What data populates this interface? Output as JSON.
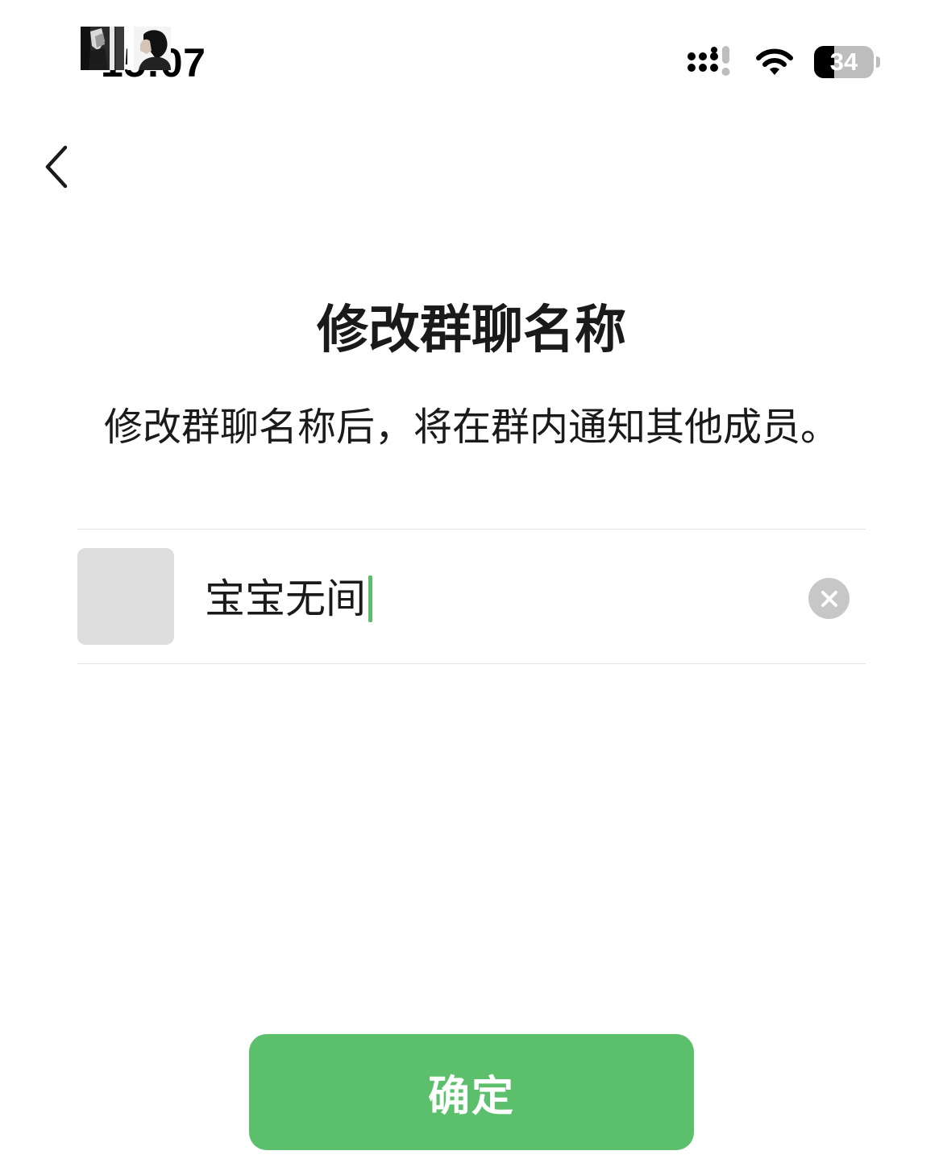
{
  "status_bar": {
    "time": "15:07",
    "battery_level": "34",
    "signal_icon": "cellular-signal-icon",
    "wifi_icon": "wifi-icon",
    "battery_icon": "battery-icon"
  },
  "nav": {
    "back_icon": "chevron-left-icon"
  },
  "heading": {
    "title": "修改群聊名称",
    "description": "修改群聊名称后，将在群内通知其他成员。"
  },
  "name_field": {
    "value": "宝宝无间",
    "avatar": "group-avatar",
    "clear_icon": "clear-x-icon",
    "cursor_color": "#5bbf6c"
  },
  "actions": {
    "confirm_label": "确定"
  },
  "colors": {
    "accent": "#5bbf6c",
    "divider": "#e2e2e2",
    "clear_button": "#c7c7c7"
  }
}
